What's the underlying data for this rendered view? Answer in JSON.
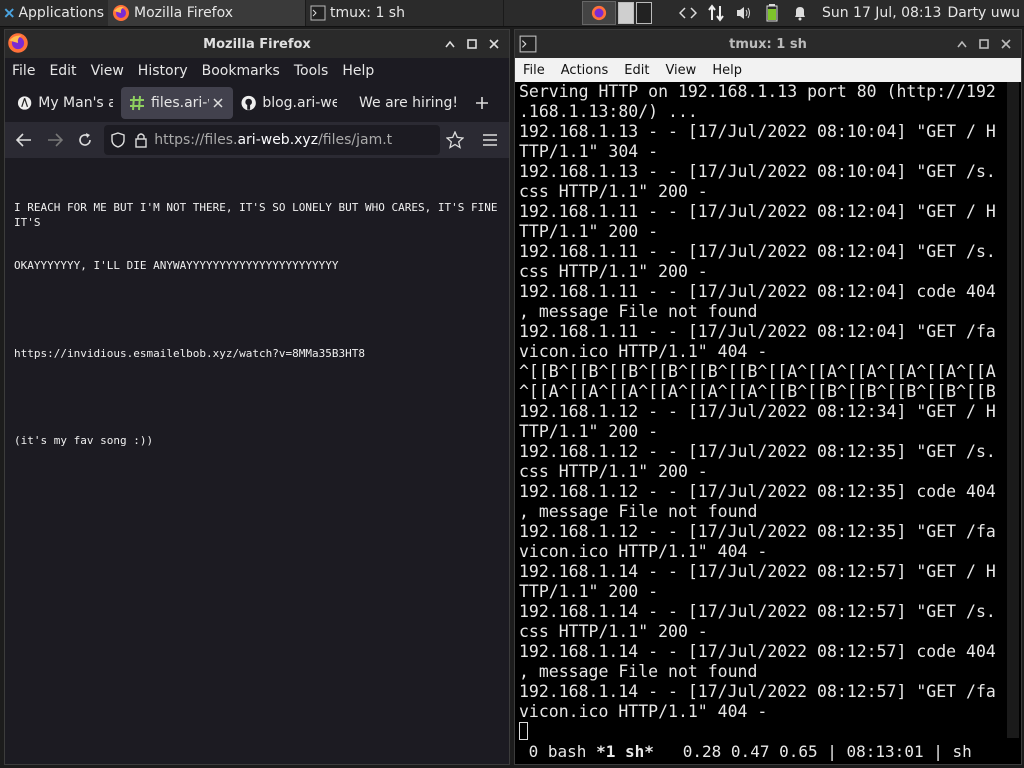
{
  "panel": {
    "applications": "Applications",
    "tasks": [
      {
        "label": "Mozilla Firefox"
      },
      {
        "label": "tmux: 1 sh"
      }
    ],
    "clock": "Sun 17 Jul, 08:13",
    "user": "Darty uwu"
  },
  "firefox": {
    "title": "Mozilla Firefox",
    "menu": [
      "File",
      "Edit",
      "View",
      "History",
      "Bookmarks",
      "Tools",
      "Help"
    ],
    "tabs": [
      {
        "label": "My Man's a"
      },
      {
        "label": "files.ari-w"
      },
      {
        "label": "blog.ari-we"
      },
      {
        "label": "We are hiring!"
      }
    ],
    "url_prefix": "https://files.",
    "url_host": "ari-web.xyz",
    "url_path": "/files/jam.t",
    "content": {
      "line1": "I REACH FOR ME BUT I'M NOT THERE, IT'S SO LONELY BUT WHO CARES, IT'S FINE IT'S",
      "line2": "OKAYYYYYYY, I'LL DIE ANYWAYYYYYYYYYYYYYYYYYYYYYYY",
      "line3": "https://invidious.esmailelbob.xyz/watch?v=8MMa35B3HT8",
      "line4": "(it's my fav song :))"
    }
  },
  "terminal": {
    "title": "tmux: 1 sh",
    "menu": [
      "File",
      "Actions",
      "Edit",
      "View",
      "Help"
    ],
    "lines": [
      "Serving HTTP on 192.168.1.13 port 80 (http://192",
      ".168.1.13:80/) ...",
      "192.168.1.13 - - [17/Jul/2022 08:10:04] \"GET / H",
      "TTP/1.1\" 304 -",
      "192.168.1.13 - - [17/Jul/2022 08:10:04] \"GET /s.",
      "css HTTP/1.1\" 200 -",
      "192.168.1.11 - - [17/Jul/2022 08:12:04] \"GET / H",
      "TTP/1.1\" 200 -",
      "192.168.1.11 - - [17/Jul/2022 08:12:04] \"GET /s.",
      "css HTTP/1.1\" 200 -",
      "192.168.1.11 - - [17/Jul/2022 08:12:04] code 404",
      ", message File not found",
      "192.168.1.11 - - [17/Jul/2022 08:12:04] \"GET /fa",
      "vicon.ico HTTP/1.1\" 404 -",
      "^[[B^[[B^[[B^[[B^[[B^[[B^[[A^[[A^[[A^[[A^[[A^[[A",
      "^[[A^[[A^[[A^[[A^[[A^[[A^[[B^[[B^[[B^[[B^[[B^[[B",
      "192.168.1.12 - - [17/Jul/2022 08:12:34] \"GET / H",
      "TTP/1.1\" 200 -",
      "192.168.1.12 - - [17/Jul/2022 08:12:35] \"GET /s.",
      "css HTTP/1.1\" 200 -",
      "192.168.1.12 - - [17/Jul/2022 08:12:35] code 404",
      ", message File not found",
      "192.168.1.12 - - [17/Jul/2022 08:12:35] \"GET /fa",
      "vicon.ico HTTP/1.1\" 404 -",
      "192.168.1.14 - - [17/Jul/2022 08:12:57] \"GET / H",
      "TTP/1.1\" 200 -",
      "192.168.1.14 - - [17/Jul/2022 08:12:57] \"GET /s.",
      "css HTTP/1.1\" 200 -",
      "192.168.1.14 - - [17/Jul/2022 08:12:57] code 404",
      ", message File not found",
      "192.168.1.14 - - [17/Jul/2022 08:12:57] \"GET /fa",
      "vicon.ico HTTP/1.1\" 404 -"
    ],
    "status": {
      "win0": " 0 bash ",
      "win1": "*1 sh*",
      "load": "   0.28 0.47 0.65 | 08:13:01 | sh"
    }
  },
  "colors": {
    "panel_bg": "#2b2b2b",
    "firefox_bg": "#1c1b22",
    "tab_selected": "#42414d",
    "terminal_bg": "#000000"
  }
}
